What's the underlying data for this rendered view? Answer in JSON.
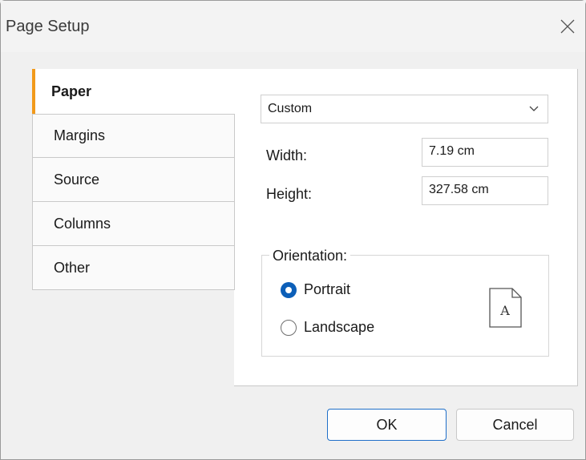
{
  "window": {
    "title": "Page Setup"
  },
  "tabs": [
    {
      "label": "Paper",
      "active": true
    },
    {
      "label": "Margins",
      "active": false
    },
    {
      "label": "Source",
      "active": false
    },
    {
      "label": "Columns",
      "active": false
    },
    {
      "label": "Other",
      "active": false
    }
  ],
  "paper": {
    "size_selected": "Custom",
    "width_label": "Width:",
    "width_value": "7.19 cm",
    "height_label": "Height:",
    "height_value": "327.58 cm",
    "orientation": {
      "title": "Orientation:",
      "portrait_label": "Portrait",
      "landscape_label": "Landscape",
      "selected": "portrait",
      "preview_letter": "A"
    }
  },
  "buttons": {
    "ok": "OK",
    "cancel": "Cancel"
  },
  "colors": {
    "accent": "#f29a1b",
    "radio_selected": "#0c5fb8",
    "default_button_border": "#1f6fc9"
  },
  "icons": {
    "close": "close-icon",
    "dropdown": "chevron-down-icon",
    "preview": "page-portrait-icon"
  }
}
